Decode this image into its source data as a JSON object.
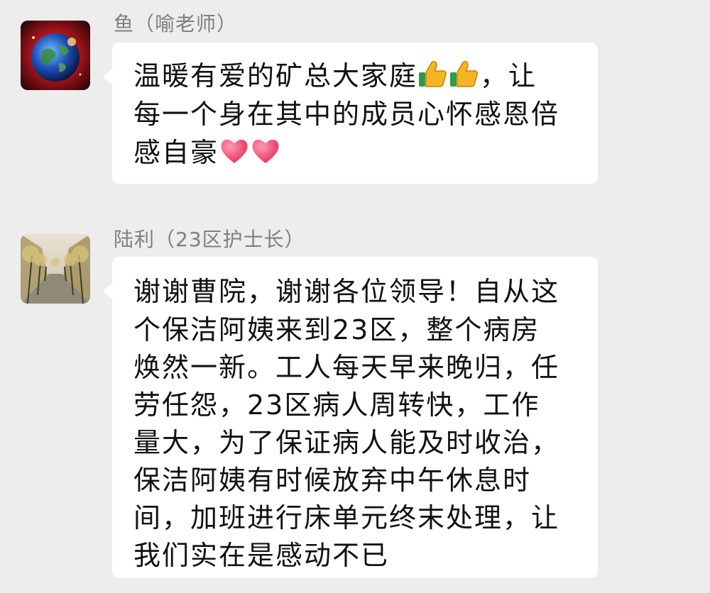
{
  "messages": [
    {
      "sender": "鱼（喻老师）",
      "avatar_icon": "earth-planet-avatar",
      "lines": [
        "温暖有爱的矿总大家庭",
        "，让",
        "每一个身在其中的成员心怀感恩倍",
        "感自豪"
      ],
      "emoji_after_line1": [
        "thumbs-up-icon",
        "thumbs-up-icon"
      ],
      "emoji_after_line4": [
        "heart-icon",
        "heart-icon"
      ]
    },
    {
      "sender": "陆利（23区护士长）",
      "avatar_icon": "tree-lined-road-avatar",
      "lines": [
        "谢谢曹院，谢谢各位领导！自从这",
        "个保洁阿姨来到23区，整个病房",
        "焕然一新。工人每天早来晚归，任",
        "劳任怨，23区病人周转快，工作",
        "量大，为了保证病人能及时收治，",
        "保洁阿姨有时候放弃中午休息时",
        "间，加班进行床单元终末处理，让",
        "我们实在是感动不已"
      ]
    }
  ],
  "colors": {
    "background": "#ededed",
    "bubble": "#ffffff",
    "sender_text": "#7f7f7f",
    "message_text": "#111111"
  }
}
